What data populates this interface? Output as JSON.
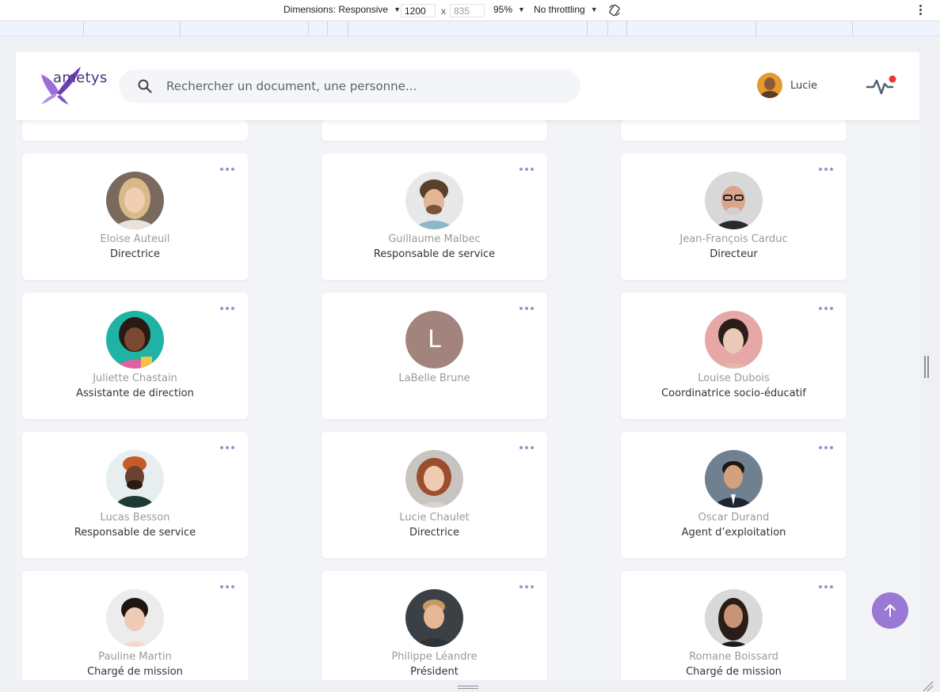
{
  "devtools": {
    "dimensions_label": "Dimensions: Responsive",
    "width": "1200",
    "height": "835",
    "times": "x",
    "zoom": "95%",
    "throttling": "No throttling"
  },
  "header": {
    "logo_text": "ametys",
    "search_placeholder": "Rechercher un document, une personne...",
    "user_name": "Lucie",
    "notification_color": "#e53935"
  },
  "people": [
    {
      "name": "Eloise Auteuil",
      "role": "Directrice",
      "photo": "photo-woman-blonde"
    },
    {
      "name": "Guillaume Malbec",
      "role": "Responsable de service",
      "photo": "photo-man-curly"
    },
    {
      "name": "Jean-François Carduc",
      "role": "Directeur",
      "photo": "photo-man-glasses"
    },
    {
      "name": "Juliette Chastain",
      "role": "Assistante de direction",
      "photo": "photo-woman-braids"
    },
    {
      "name": "LaBelle Brune",
      "role": "",
      "initial": "L",
      "photo": "initial-avatar"
    },
    {
      "name": "Louise Dubois",
      "role": "Coordinatrice socio-éducatif",
      "photo": "photo-woman-dark-hair"
    },
    {
      "name": "Lucas Besson",
      "role": "Responsable de service",
      "photo": "photo-man-beanie"
    },
    {
      "name": "Lucie Chaulet",
      "role": "Directrice",
      "photo": "photo-woman-red-hair"
    },
    {
      "name": "Oscar Durand",
      "role": "Agent d’exploitation",
      "photo": "photo-man-suit"
    },
    {
      "name": "Pauline Martin",
      "role": "Chargé de mission",
      "photo": "photo-woman-smile"
    },
    {
      "name": "Philippe Léandre",
      "role": "Président",
      "photo": "photo-man-blond"
    },
    {
      "name": "Romane Boissard",
      "role": "Chargé de mission",
      "photo": "photo-woman-long-hair"
    }
  ],
  "colors": {
    "accent": "#9a78d6",
    "menu_dots": "#a08fd0",
    "initial_bg": "#a3847d"
  }
}
